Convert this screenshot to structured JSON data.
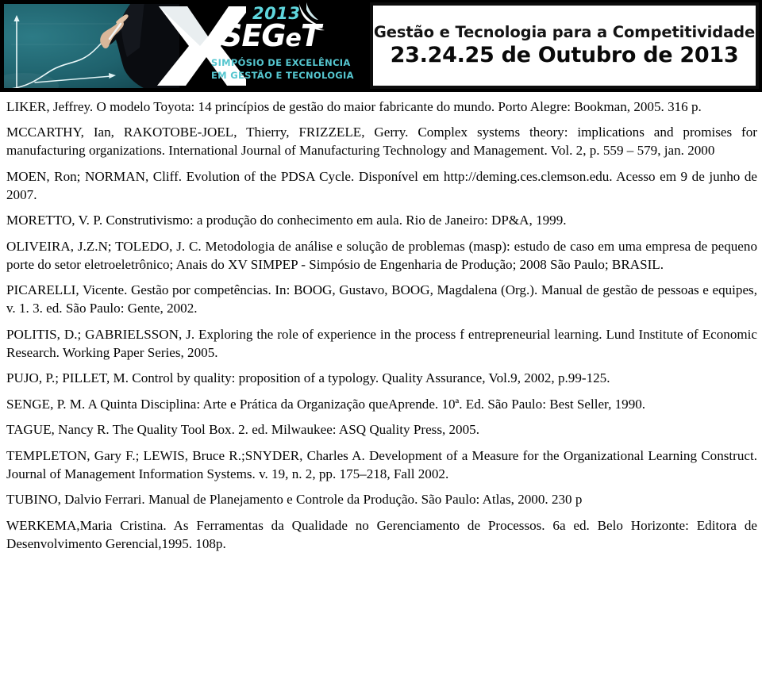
{
  "banner": {
    "logo": {
      "year": "2013",
      "acronym_main": "SEG",
      "acronym_lower": "e",
      "acronym_tail": "T",
      "subtitle_line1": "SIMPÓSIO DE EXCELÊNCIA",
      "subtitle_line2": "EM GESTÃO E TECNOLOGIA",
      "teal": "#55c6cf",
      "year_color": "#5fd6dd"
    },
    "title_card": {
      "line1": "Gestão e Tecnologia para a Competitividade",
      "line2": "23.24.25 de Outubro de 2013"
    }
  },
  "document": {
    "references": [
      "LIKER, Jeffrey. O modelo Toyota: 14 princípios de gestão do maior fabricante do mundo. Porto Alegre: Bookman, 2005. 316 p.",
      "MCCARTHY, Ian, RAKOTOBE-JOEL, Thierry, FRIZZELE, Gerry. Complex systems theory: implications and promises for manufacturing organizations. International Journal of Manufacturing Technology and Management. Vol. 2, p. 559 – 579, jan. 2000",
      "MOEN, Ron; NORMAN, Cliff. Evolution of the PDSA Cycle. Disponível em http://deming.ces.clemson.edu. Acesso em 9 de junho de 2007.",
      "MORETTO, V. P. Construtivismo: a produção do conhecimento em aula. Rio de Janeiro: DP&A, 1999.",
      "OLIVEIRA, J.Z.N; TOLEDO, J. C. Metodologia de análise e solução de problemas (masp): estudo de caso em uma empresa de pequeno porte do setor eletroeletrônico; Anais do XV SIMPEP - Simpósio de Engenharia de Produção; 2008 São Paulo; BRASIL.",
      "PICARELLI, Vicente. Gestão por competências. In: BOOG, Gustavo, BOOG,  Magdalena (Org.). Manual de gestão de pessoas e equipes, v. 1. 3. ed. São Paulo: Gente, 2002.",
      "POLITIS, D.; GABRIELSSON, J. Exploring the role of experience in the process f entrepreneurial learning. Lund Institute of Economic Research. Working Paper Series, 2005.",
      "PUJO, P.; PILLET, M. Control by quality: proposition of a typology. Quality Assurance, Vol.9, 2002, p.99-125.",
      "SENGE, P. M. A Quinta Disciplina: Arte e Prática da Organização queAprende. 10ª. Ed. São Paulo: Best Seller, 1990.",
      "TAGUE, Nancy R. The Quality Tool Box. 2. ed. Milwaukee: ASQ Quality Press, 2005.",
      "TEMPLETON, Gary F.; LEWIS, Bruce R.;SNYDER, Charles A. Development of a Measure for the Organizational Learning Construct. Journal of Management Information Systems.  v. 19, n. 2, pp. 175–218, Fall 2002.",
      "TUBINO, Dalvio Ferrari. Manual de Planejamento e Controle da Produção. São Paulo: Atlas, 2000. 230 p",
      "WERKEMA,Maria Cristina. As Ferramentas da Qualidade no Gerenciamento de Processos. 6a ed. Belo Horizonte: Editora de Desenvolvimento Gerencial,1995. 108p."
    ]
  }
}
